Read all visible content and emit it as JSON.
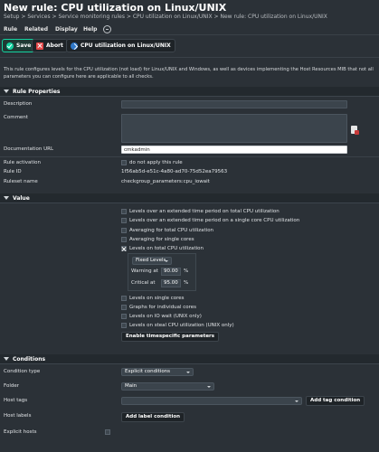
{
  "header": {
    "title": "New rule: CPU utilization on Linux/UNIX",
    "breadcrumb": [
      "Setup",
      "Services",
      "Service monitoring rules",
      "CPU utilization on Linux/UNIX",
      "New rule: CPU utilization on Linux/UNIX"
    ],
    "breadcrumb_sep": " > "
  },
  "menubar": {
    "items": [
      "Rule",
      "Related",
      "Display",
      "Help"
    ]
  },
  "toolbar": {
    "save_label": "Save",
    "abort_label": "Abort",
    "ruleset_link_label": "CPU utilization on Linux/UNIX"
  },
  "intro": "This rule configures levels for the CPU utilization (not load) for Linux/UNIX and Windows, as well as devices implementing the Host Resources MIB that not all parameters you can configure here are applicable to all checks.",
  "rule_properties": {
    "section_title": "Rule Properties",
    "description_label": "Description",
    "description_value": "",
    "comment_label": "Comment",
    "comment_value": "",
    "documentation_label": "Documentation URL",
    "documentation_value": "cmkadmin",
    "activation_label": "Rule activation",
    "activation_option": "do not apply this rule",
    "activation_checked": false,
    "rule_id_label": "Rule ID",
    "rule_id_value": "1f56ab5d-e51c-4a80-ad70-75d52ea79563",
    "ruleset_label": "Ruleset name",
    "ruleset_value": "checkgroup_parameters:cpu_iowait"
  },
  "value": {
    "section_title": "Value",
    "options": [
      {
        "label": "Levels over an extended time period on total CPU utilization",
        "checked": false
      },
      {
        "label": "Levels over an extended time period on a single core CPU utilization",
        "checked": false
      },
      {
        "label": "Averaging for total CPU utilization",
        "checked": false
      },
      {
        "label": "Averaging for single cores",
        "checked": false
      },
      {
        "label": "Levels on total CPU utilization",
        "checked": true
      }
    ],
    "levels": {
      "mode": "Fixed Levels",
      "warning_label": "Warning at",
      "warning_value": "90.00",
      "critical_label": "Critical at",
      "critical_value": "95.00",
      "unit": "%"
    },
    "more_options": [
      {
        "label": "Levels on single cores",
        "checked": false
      },
      {
        "label": "Graphs for individual cores",
        "checked": false
      },
      {
        "label": "Levels on IO wait (UNIX only)",
        "checked": false
      },
      {
        "label": "Levels on steal CPU utilization (UNIX only)",
        "checked": false
      }
    ],
    "timespecific_button": "Enable timespecific parameters"
  },
  "conditions": {
    "section_title": "Conditions",
    "condition_type_label": "Condition type",
    "condition_type_value": "Explicit conditions",
    "folder_label": "Folder",
    "folder_value": "Main",
    "host_tags_label": "Host tags",
    "host_tags_value": "",
    "add_tag_button": "Add tag condition",
    "host_labels_label": "Host labels",
    "add_label_button": "Add label condition",
    "explicit_hosts_label": "Explicit hosts",
    "explicit_hosts_checked": false
  }
}
